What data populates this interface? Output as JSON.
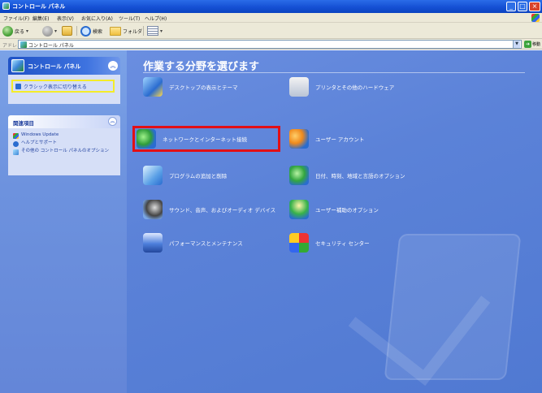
{
  "window": {
    "title": "コントロール パネル"
  },
  "menu": {
    "items": [
      "ファイル(F)",
      "編集(E)",
      "表示(V)",
      "お気に入り(A)",
      "ツール(T)",
      "ヘルプ(H)"
    ]
  },
  "toolbar": {
    "back_label": "戻る",
    "search_label": "検索",
    "folders_label": "フォルダ"
  },
  "address": {
    "label": "アドレス(D)",
    "value": "コントロール パネル",
    "go_label": "移動"
  },
  "left_pane": {
    "control_panel": {
      "title": "コントロール パネル",
      "switch_label": "クラシック表示に切り替える"
    },
    "related": {
      "title": "関連項目",
      "items": [
        {
          "label": "Windows Update",
          "icon": "winupdate-icon"
        },
        {
          "label": "ヘルプとサポート",
          "icon": "help-icon"
        },
        {
          "label": "その他の コントロール パネルのオプション",
          "icon": "cpanel-icon"
        }
      ]
    }
  },
  "main": {
    "heading": "作業する分野を選びます",
    "categories": [
      {
        "label": "デスクトップの表示とテーマ",
        "icon": "appearance-icon"
      },
      {
        "label": "プリンタとその他のハードウェア",
        "icon": "printers-icon"
      },
      {
        "label": "ネットワークとインターネット接続",
        "icon": "network-icon",
        "highlighted": true
      },
      {
        "label": "ユーザー アカウント",
        "icon": "users-icon"
      },
      {
        "label": "プログラムの追加と削除",
        "icon": "programs-icon"
      },
      {
        "label": "日付、時刻、地域と言語のオプション",
        "icon": "datetime-icon"
      },
      {
        "label": "サウンド、音声、およびオーディオ デバイス",
        "icon": "sound-icon"
      },
      {
        "label": "ユーザー補助のオプション",
        "icon": "accessibility-icon"
      },
      {
        "label": "パフォーマンスとメンテナンス",
        "icon": "performance-icon"
      },
      {
        "label": "セキュリティ センター",
        "icon": "security-icon"
      }
    ]
  },
  "colors": {
    "highlight_box": "#e20f15",
    "switch_outline": "#f4ec2a",
    "task_pane_bg": "#7ba2e7",
    "main_bg": "#5b82d8"
  }
}
